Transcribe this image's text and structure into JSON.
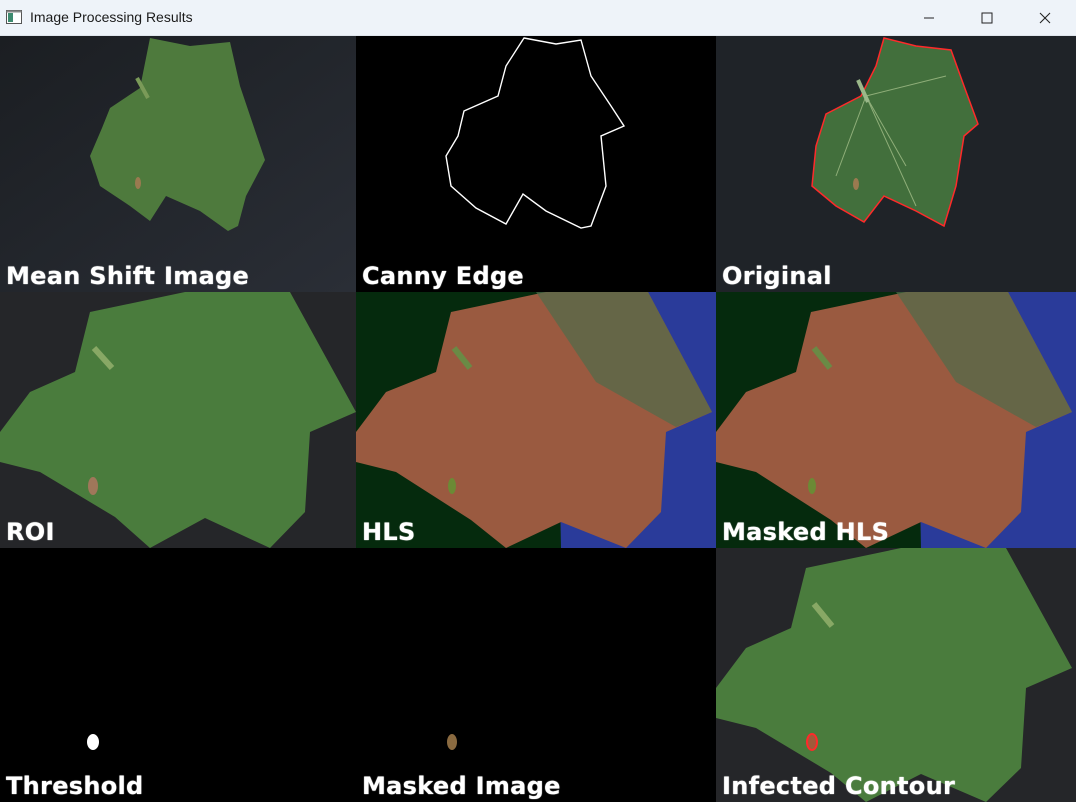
{
  "window": {
    "title": "Image Processing Results",
    "icon": "app-window-icon",
    "controls": [
      "minimize-icon",
      "maximize-icon",
      "close-icon"
    ]
  },
  "panels": [
    {
      "id": "mean-shift",
      "label": "Mean Shift Image"
    },
    {
      "id": "canny-edge",
      "label": "Canny Edge"
    },
    {
      "id": "original",
      "label": "Original"
    },
    {
      "id": "roi",
      "label": "ROI"
    },
    {
      "id": "hls",
      "label": "HLS"
    },
    {
      "id": "masked-hls",
      "label": "Masked HLS"
    },
    {
      "id": "threshold",
      "label": "Threshold"
    },
    {
      "id": "masked-image",
      "label": "Masked Image"
    },
    {
      "id": "infected-contour",
      "label": "Infected Contour"
    }
  ],
  "colors": {
    "leaf_green": "#4c7b3f",
    "background_dark": "#22262b",
    "hls_red": "#b35a40",
    "hls_blue": "#2a3b9a",
    "contour_red": "#ff2a2a"
  }
}
